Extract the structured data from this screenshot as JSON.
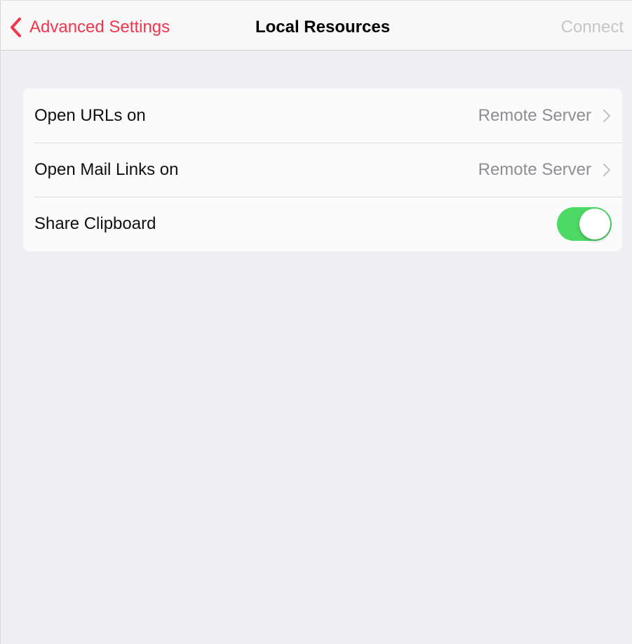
{
  "navbar": {
    "back_label": "Advanced Settings",
    "title": "Local Resources",
    "action_label": "Connect"
  },
  "settings": {
    "rows": [
      {
        "label": "Open URLs on",
        "value": "Remote Server"
      },
      {
        "label": "Open Mail Links on",
        "value": "Remote Server"
      },
      {
        "label": "Share Clipboard",
        "toggle_on": true
      }
    ]
  },
  "colors": {
    "accent": "#f2364d",
    "toggle_on": "#4cd964",
    "background": "#f0eff4",
    "secondary_text": "#8e8e93",
    "disabled_text": "#c6c6c8"
  },
  "icons": {
    "back": "chevron-left-icon",
    "disclosure": "chevron-right-icon"
  }
}
